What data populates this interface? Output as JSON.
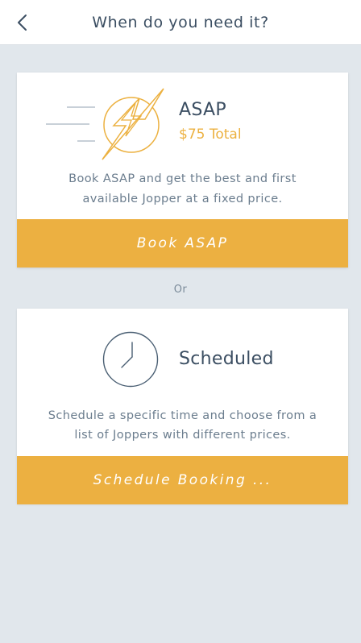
{
  "header": {
    "title": "When do you need it?",
    "back_icon": "chevron-left-icon"
  },
  "asap": {
    "title": "ASAP",
    "price": "$75 Total",
    "description_line1": "Book ASAP and get the best and first",
    "description_line2": "available Jopper at a fixed price.",
    "button_label": "Book ASAP",
    "icon": "lightning-bolt-icon"
  },
  "separator": "Or",
  "scheduled": {
    "title": "Scheduled",
    "description_line1": "Schedule a specific time and choose from a",
    "description_line2": "list of Joppers with different prices.",
    "button_label": "Schedule Booking ...",
    "icon": "clock-icon"
  },
  "colors": {
    "accent": "#ECB041",
    "background": "#E1E7EC",
    "text": "#3B4E62"
  }
}
